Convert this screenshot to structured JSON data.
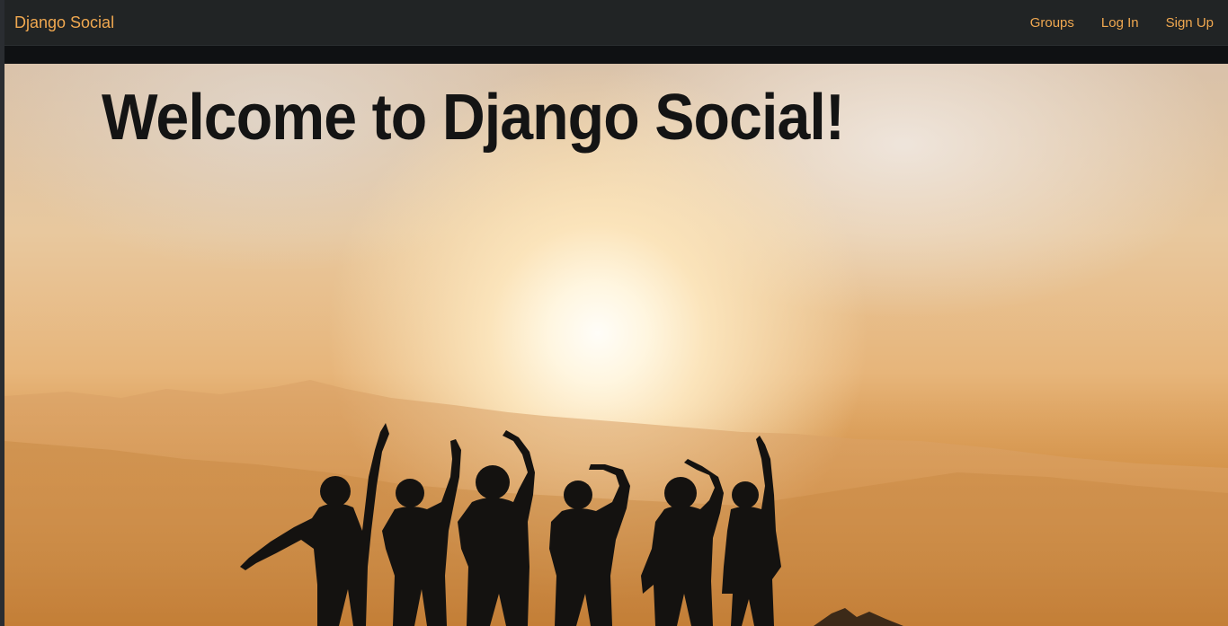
{
  "navbar": {
    "brand": "Django Social",
    "links": [
      {
        "label": "Groups"
      },
      {
        "label": "Log In"
      },
      {
        "label": "Sign Up"
      }
    ]
  },
  "hero": {
    "title": "Welcome to Django Social!",
    "image": "silhouettes-of-people-waving-at-sunset"
  },
  "colors": {
    "nav_background": "#212425",
    "link_color": "#f0a850",
    "title_color": "#141414"
  }
}
